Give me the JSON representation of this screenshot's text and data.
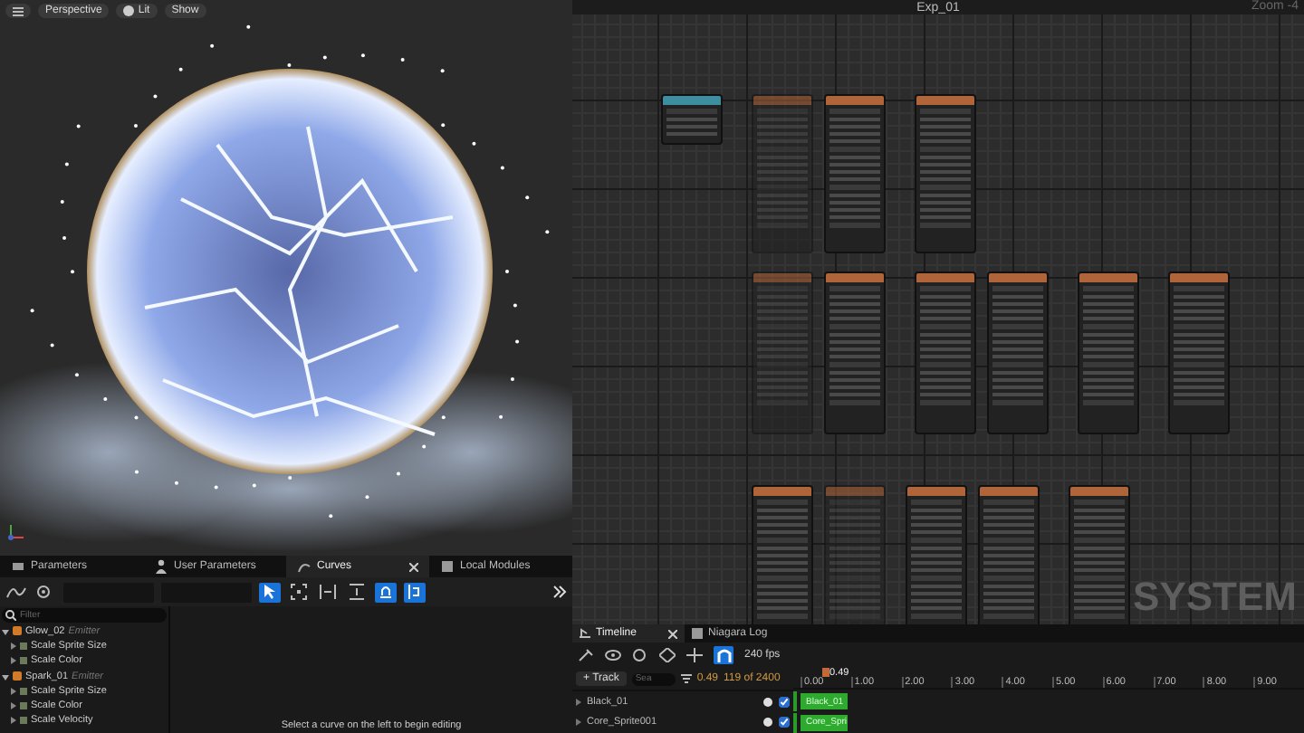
{
  "viewport": {
    "toolbar": [
      "Perspective",
      "Lit",
      "Show"
    ]
  },
  "graph": {
    "title": "Exp_01",
    "zoom": "Zoom -4",
    "overlay": "SYSTEM",
    "rows": [
      [
        {
          "kind": "system",
          "disabled": false
        },
        {
          "kind": "emitter",
          "disabled": true
        },
        {
          "kind": "emitter",
          "disabled": false
        },
        {
          "kind": "emitter",
          "disabled": false
        }
      ],
      [
        {
          "kind": "emitter",
          "disabled": true
        },
        {
          "kind": "emitter",
          "disabled": false
        },
        {
          "kind": "emitter",
          "disabled": false
        },
        {
          "kind": "emitter",
          "disabled": false
        },
        {
          "kind": "emitter",
          "disabled": false
        },
        {
          "kind": "emitter",
          "disabled": false
        }
      ],
      [
        {
          "kind": "emitter",
          "disabled": false
        },
        {
          "kind": "emitter",
          "disabled": true
        },
        {
          "kind": "emitter",
          "disabled": false
        },
        {
          "kind": "emitter",
          "disabled": false
        },
        {
          "kind": "emitter",
          "disabled": false
        }
      ]
    ]
  },
  "curves": {
    "tabs": [
      {
        "label": "Parameters",
        "selected": false
      },
      {
        "label": "User Parameters",
        "selected": false
      },
      {
        "label": "Curves",
        "selected": true
      },
      {
        "label": "Local Modules",
        "selected": false
      }
    ],
    "tools": [
      {
        "kind": "select",
        "on": true
      },
      {
        "kind": "frame",
        "on": false
      },
      {
        "kind": "fit-h",
        "on": false
      },
      {
        "kind": "fit-v",
        "on": false
      },
      {
        "kind": "snap-value",
        "on": true
      },
      {
        "kind": "snap-time",
        "on": true
      }
    ],
    "filter": {
      "placeholder": "Filter"
    },
    "tree": [
      {
        "label": "Glow_02",
        "tag": "Emitter",
        "expanded": true,
        "children": [
          {
            "label": "Scale Sprite Size",
            "expanded": false
          },
          {
            "label": "Scale Color",
            "expanded": false
          }
        ]
      },
      {
        "label": "Spark_01",
        "tag": "Emitter",
        "expanded": true,
        "children": [
          {
            "label": "Scale Sprite Size",
            "expanded": false
          },
          {
            "label": "Scale Color",
            "expanded": false
          },
          {
            "label": "Scale Velocity",
            "expanded": false
          }
        ]
      }
    ],
    "message": "Select a curve on the left to begin editing"
  },
  "timeline": {
    "tabs": [
      {
        "label": "Timeline",
        "selected": true
      },
      {
        "label": "Niagara Log",
        "selected": false
      }
    ],
    "fps": "240 fps",
    "snap": true,
    "add_track": "+ Track",
    "search": {
      "placeholder": "Sea"
    },
    "time": "0.49",
    "frame": "119 of 2400",
    "playhead": "0.49",
    "ruler": [
      "0.00",
      "1.00",
      "2.00",
      "3.00",
      "4.00",
      "5.00",
      "6.00",
      "7.00",
      "8.00",
      "9.00"
    ],
    "tracks": [
      {
        "name": "Black_01",
        "enabled": true,
        "bar": "Black_01"
      },
      {
        "name": "Core_Sprite001",
        "enabled": true,
        "bar": "Core_Spri"
      }
    ]
  }
}
